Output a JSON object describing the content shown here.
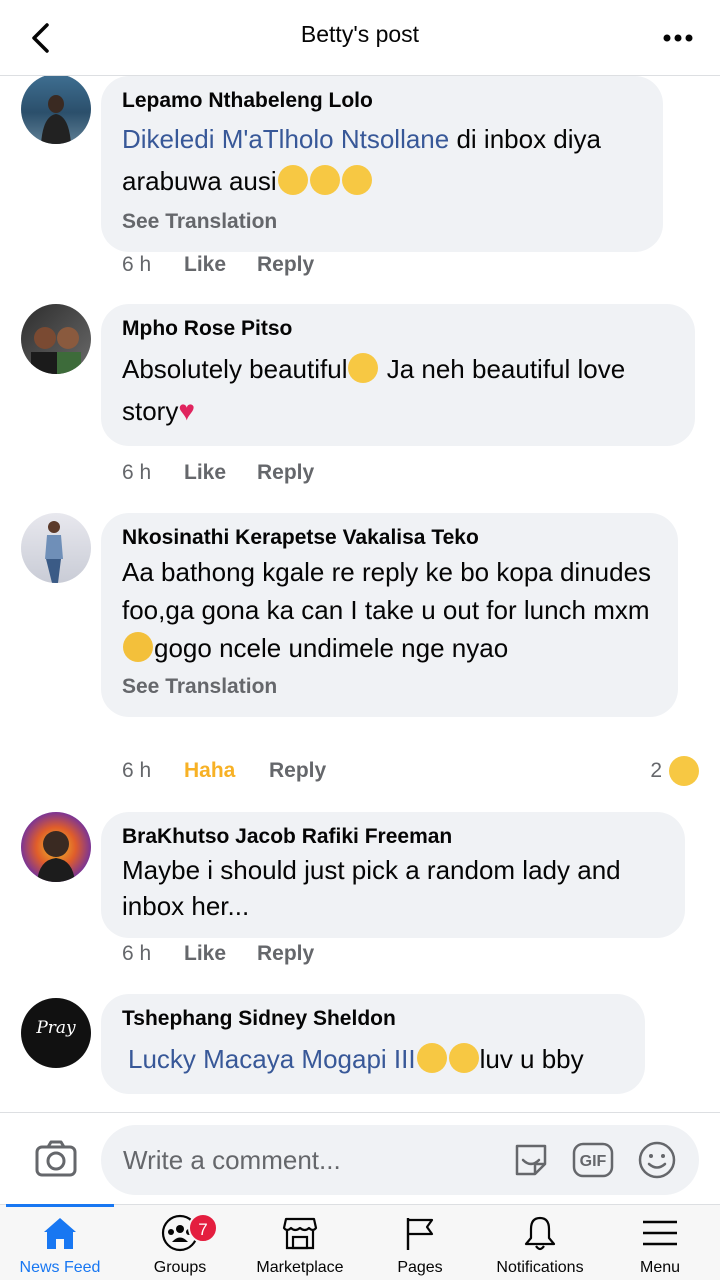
{
  "header": {
    "title": "Betty's post"
  },
  "comments": [
    {
      "name": "Lepamo Nthabeleng Lolo",
      "mention": "Dikeledi M'aTlholo Ntsollane",
      "text": " di inbox diya arabuwa ausi",
      "see_translation": "See Translation",
      "time": "6 h",
      "like": "Like",
      "reply": "Reply"
    },
    {
      "name": "Mpho Rose Pitso",
      "text_1": "Absolutely beautiful",
      "text_2": " Ja neh beautiful love story",
      "time": "6 h",
      "like": "Like",
      "reply": "Reply"
    },
    {
      "name": "Nkosinathi Kerapetse Vakalisa Teko",
      "text_1": "Aa bathong kgale re reply ke bo kopa dinudes foo,ga gona ka can I take u out for lunch mxm",
      "text_2": "gogo ncele undimele nge nyao",
      "see_translation": "See Translation",
      "time": "6 h",
      "reaction_label": "Haha",
      "reply": "Reply",
      "reaction_count": "2"
    },
    {
      "name": "BraKhutso Jacob Rafiki Freeman",
      "text": "Maybe i should just pick a random lady and inbox her...",
      "time": "6 h",
      "like": "Like",
      "reply": "Reply"
    },
    {
      "name": "Tshephang Sidney Sheldon",
      "mention": "Lucky Macaya Mogapi III",
      "text": "luv u bby",
      "avatar_text": "Pray"
    }
  ],
  "composer": {
    "placeholder": "Write a comment..."
  },
  "tabs": [
    {
      "label": "News Feed",
      "icon": "home-icon"
    },
    {
      "label": "Groups",
      "icon": "groups-icon",
      "badge": "7"
    },
    {
      "label": "Marketplace",
      "icon": "marketplace-icon"
    },
    {
      "label": "Pages",
      "icon": "flag-icon"
    },
    {
      "label": "Notifications",
      "icon": "bell-icon"
    },
    {
      "label": "Menu",
      "icon": "hamburger-icon"
    }
  ],
  "colors": {
    "accent": "#1877f2",
    "mention": "#385898",
    "haha": "#f7b125",
    "bubble": "#f0f2f5",
    "badge": "#e41e3f"
  }
}
